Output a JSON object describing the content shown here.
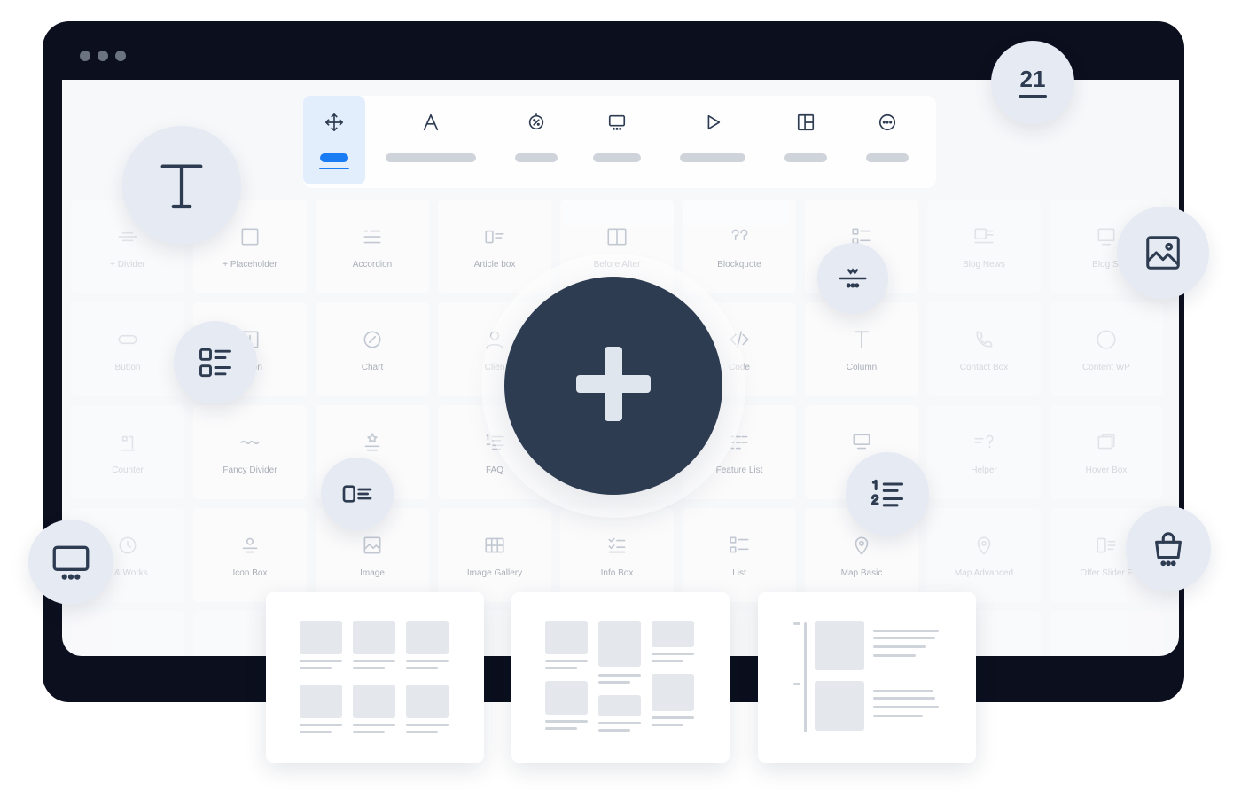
{
  "window": {
    "controls": [
      "dot",
      "dot",
      "dot"
    ]
  },
  "toolbar": {
    "tabs": [
      {
        "icon": "move-icon",
        "active": true
      },
      {
        "icon": "text-style-icon",
        "active": false
      },
      {
        "icon": "percent-badge-icon",
        "active": false
      },
      {
        "icon": "monitor-icon",
        "active": false
      },
      {
        "icon": "play-icon",
        "active": false
      },
      {
        "icon": "layout-icon",
        "active": false
      },
      {
        "icon": "more-icon",
        "active": false
      }
    ]
  },
  "elements": [
    {
      "label": "+ Divider",
      "icon": "divider-icon"
    },
    {
      "label": "+ Placeholder",
      "icon": "placeholder-icon"
    },
    {
      "label": "Accordion",
      "icon": "accordion-icon"
    },
    {
      "label": "Article box",
      "icon": "article-box-icon"
    },
    {
      "label": "Before After",
      "icon": "before-after-icon"
    },
    {
      "label": "Blockquote",
      "icon": "blockquote-icon"
    },
    {
      "label": "",
      "icon": "list-icon"
    },
    {
      "label": "Blog News",
      "icon": "blog-news-icon"
    },
    {
      "label": "Blog Sl",
      "icon": "blog-slider-icon"
    },
    {
      "label": "Button",
      "icon": "button-icon"
    },
    {
      "label": "Action",
      "icon": "call-action-icon"
    },
    {
      "label": "Chart",
      "icon": "chart-icon"
    },
    {
      "label": "Clien",
      "icon": "clients-icon"
    },
    {
      "label": "",
      "icon": "blank-icon"
    },
    {
      "label": "Code",
      "icon": "code-icon"
    },
    {
      "label": "Column",
      "icon": "column-icon"
    },
    {
      "label": "Contact Box",
      "icon": "contact-box-icon"
    },
    {
      "label": "Content WP",
      "icon": "content-wp-icon"
    },
    {
      "label": "Counter",
      "icon": "counter-icon"
    },
    {
      "label": "Fancy Divider",
      "icon": "fancy-divider-icon"
    },
    {
      "label": "ding",
      "icon": "fancy-heading-icon"
    },
    {
      "label": "FAQ",
      "icon": "faq-icon"
    },
    {
      "label": "",
      "icon": "blank-icon"
    },
    {
      "label": "Feature List",
      "icon": "feature-list-icon"
    },
    {
      "label": "",
      "icon": "flat-box-icon"
    },
    {
      "label": "Helper",
      "icon": "helper-icon"
    },
    {
      "label": "Hover Box",
      "icon": "hover-box-icon"
    },
    {
      "label": "s & Works",
      "icon": "how-it-works-icon"
    },
    {
      "label": "Icon Box",
      "icon": "icon-box-icon"
    },
    {
      "label": "Image",
      "icon": "image-icon"
    },
    {
      "label": "Image Gallery",
      "icon": "image-gallery-icon"
    },
    {
      "label": "Info Box",
      "icon": "info-box-icon"
    },
    {
      "label": "List",
      "icon": "list-icon"
    },
    {
      "label": "Map Basic",
      "icon": "map-pin-icon"
    },
    {
      "label": "Map Advanced",
      "icon": "map-pin-icon"
    },
    {
      "label": "Offer Slider F",
      "icon": "offer-slider-icon"
    }
  ],
  "floating": {
    "calendar_day": "21"
  },
  "layouts": [
    "grid-3x2",
    "masonry",
    "list-timeline"
  ]
}
